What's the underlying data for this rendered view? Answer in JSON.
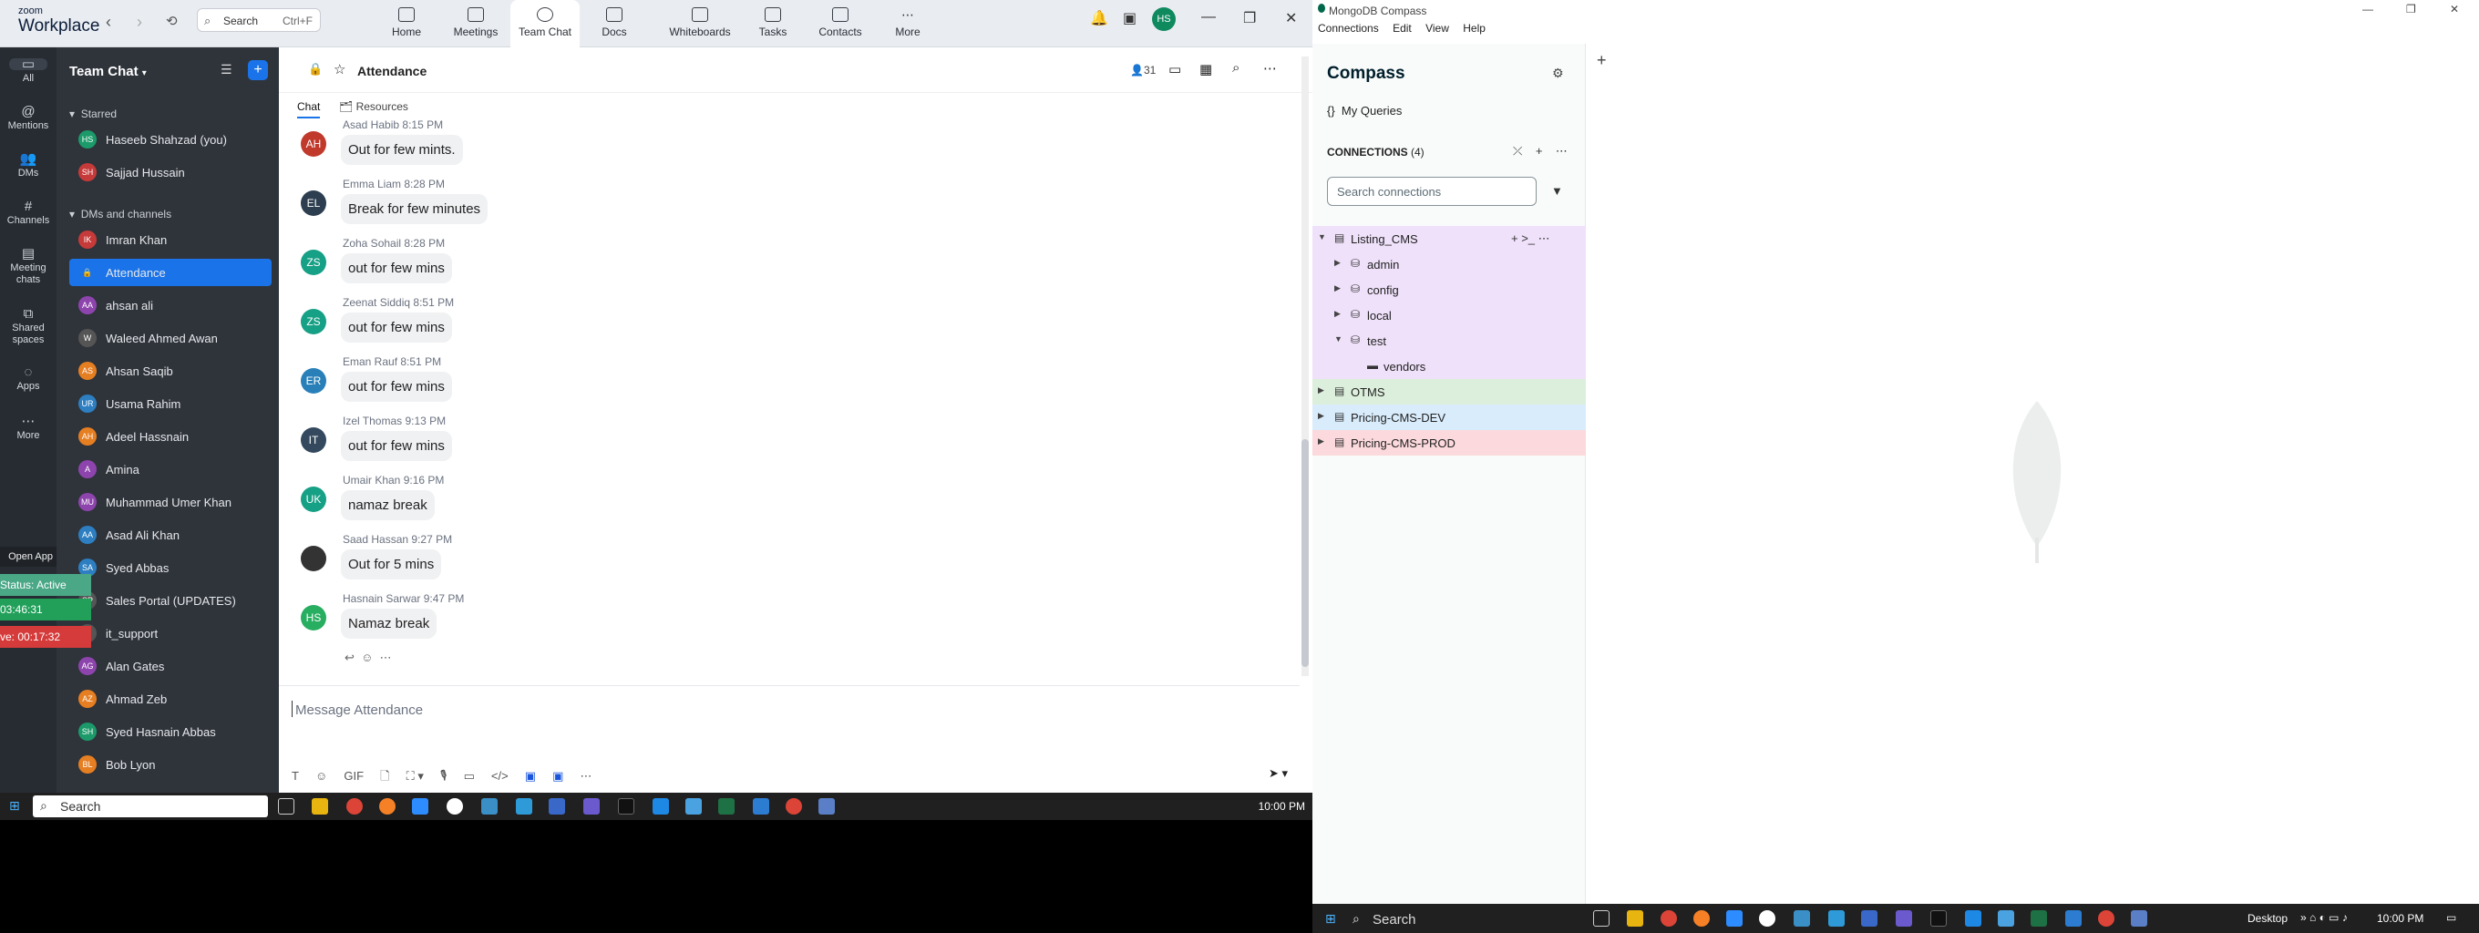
{
  "zoom": {
    "logo_small": "zoom",
    "logo_big": "Workplace",
    "search_placeholder": "Search",
    "search_shortcut": "Ctrl+F",
    "tabs": [
      {
        "label": "Home"
      },
      {
        "label": "Meetings"
      },
      {
        "label": "Team Chat"
      },
      {
        "label": "Docs"
      },
      {
        "label": "Whiteboards"
      },
      {
        "label": "Tasks"
      },
      {
        "label": "Contacts"
      },
      {
        "label": "More"
      }
    ],
    "avatar_initials": "HS",
    "rail": [
      {
        "label": "All"
      },
      {
        "label": "Mentions"
      },
      {
        "label": "DMs"
      },
      {
        "label": "Channels"
      },
      {
        "label": "Meeting chats"
      },
      {
        "label": "Shared spaces"
      },
      {
        "label": "Apps"
      },
      {
        "label": "More"
      }
    ],
    "overlay": {
      "open_app": "Open App",
      "status": "Status: Active",
      "time1": "03:46:31",
      "time2": "ve: 00:17:32"
    },
    "team_chat": {
      "title": "Team Chat",
      "sections": {
        "starred": "Starred",
        "dms": "DMs and channels"
      },
      "starred": [
        {
          "initials": "HS",
          "name": "Haseeb Shahzad (you)",
          "color": "#1c9a6a"
        },
        {
          "initials": "SH",
          "name": "Sajjad Hussain",
          "color": "#c73a3a"
        }
      ],
      "channels": [
        {
          "initials": "IK",
          "name": "Imran Khan",
          "color": "#c73a3a"
        },
        {
          "initials": "🔒",
          "name": "Attendance",
          "color": "transparent"
        },
        {
          "initials": "AA",
          "name": "ahsan ali",
          "color": "#8e44ad"
        },
        {
          "initials": "W",
          "name": "Waleed Ahmed Awan",
          "color": "#555"
        },
        {
          "initials": "AS",
          "name": "Ahsan Saqib",
          "color": "#e67e22"
        },
        {
          "initials": "UR",
          "name": "Usama Rahim",
          "color": "#2d7fc1"
        },
        {
          "initials": "AH",
          "name": "Adeel Hassnain",
          "color": "#e67e22"
        },
        {
          "initials": "A",
          "name": "Amina",
          "color": "#8e44ad"
        },
        {
          "initials": "MU",
          "name": "Muhammad Umer Khan",
          "color": "#8e44ad"
        },
        {
          "initials": "AA",
          "name": "Asad Ali Khan",
          "color": "#2d7fc1"
        },
        {
          "initials": "SA",
          "name": "Syed Abbas",
          "color": "#2d7fc1"
        },
        {
          "initials": "SP",
          "name": "Sales Portal (UPDATES)",
          "color": "#555"
        },
        {
          "initials": "it",
          "name": "it_support",
          "color": "#555"
        },
        {
          "initials": "AG",
          "name": "Alan Gates",
          "color": "#8e44ad"
        },
        {
          "initials": "AZ",
          "name": "Ahmad Zeb",
          "color": "#e67e22"
        },
        {
          "initials": "SH",
          "name": "Syed Hasnain Abbas",
          "color": "#1c9a6a"
        },
        {
          "initials": "BL",
          "name": "Bob Lyon",
          "color": "#e67e22"
        }
      ]
    },
    "chat": {
      "title": "Attendance",
      "member_count": "31",
      "tabs": [
        "Chat",
        "Resources"
      ],
      "messages": [
        {
          "author": "Asad Habib",
          "time": "8:15 PM",
          "text": "Out for few mints.",
          "initials": "AH",
          "color": "#c0392b"
        },
        {
          "author": "Emma Liam",
          "time": "8:28 PM",
          "text": "Break for few minutes",
          "initials": "EL",
          "color": "#2c3e50"
        },
        {
          "author": "Zoha Sohail",
          "time": "8:28 PM",
          "text": "out for few mins",
          "initials": "ZS",
          "color": "#16a085"
        },
        {
          "author": "Zeenat Siddiq",
          "time": "8:51 PM",
          "text": "out for few mins",
          "initials": "ZS",
          "color": "#16a085"
        },
        {
          "author": "Eman Rauf",
          "time": "8:51 PM",
          "text": "out for few mins",
          "initials": "ER",
          "color": "#2980b9"
        },
        {
          "author": "Izel Thomas",
          "time": "9:13 PM",
          "text": "out for few mins",
          "initials": "IT",
          "color": "#34495e"
        },
        {
          "author": "Umair Khan",
          "time": "9:16 PM",
          "text": "namaz break",
          "initials": "UK",
          "color": "#16a085"
        },
        {
          "author": "Saad Hassan",
          "time": "9:27 PM",
          "text": "Out for 5 mins",
          "initials": "",
          "color": "#333"
        },
        {
          "author": "Hasnain Sarwar",
          "time": "9:47 PM",
          "text": "Namaz break",
          "initials": "HS",
          "color": "#27ae60"
        }
      ],
      "composer_placeholder": "Message Attendance",
      "gif_label": "GIF"
    },
    "taskbar": {
      "search": "Search",
      "time": "10:00 PM"
    }
  },
  "compass": {
    "window_title": "MongoDB Compass",
    "menu": [
      "Connections",
      "Edit",
      "View",
      "Help"
    ],
    "brand": "Compass",
    "my_queries": "My Queries",
    "connections_label": "CONNECTIONS",
    "connections_count": "(4)",
    "search_placeholder": "Search connections",
    "tree": [
      {
        "label": "Listing_CMS",
        "level": 0,
        "expanded": true,
        "bg": "#efe1fa"
      },
      {
        "label": "admin",
        "level": 1,
        "bg": "#efe1fa"
      },
      {
        "label": "config",
        "level": 1,
        "bg": "#efe1fa"
      },
      {
        "label": "local",
        "level": 1,
        "bg": "#efe1fa"
      },
      {
        "label": "test",
        "level": 1,
        "expanded": true,
        "bg": "#efe1fa"
      },
      {
        "label": "vendors",
        "level": 2,
        "bg": "#efe1fa"
      },
      {
        "label": "OTMS",
        "level": 0,
        "bg": "#dcefdc"
      },
      {
        "label": "Pricing-CMS-DEV",
        "level": 0,
        "bg": "#d9ecfb"
      },
      {
        "label": "Pricing-CMS-PROD",
        "level": 0,
        "bg": "#fcd9dc"
      }
    ],
    "taskbar": {
      "search": "Search",
      "desktop": "Desktop",
      "time": "10:00 PM"
    }
  }
}
